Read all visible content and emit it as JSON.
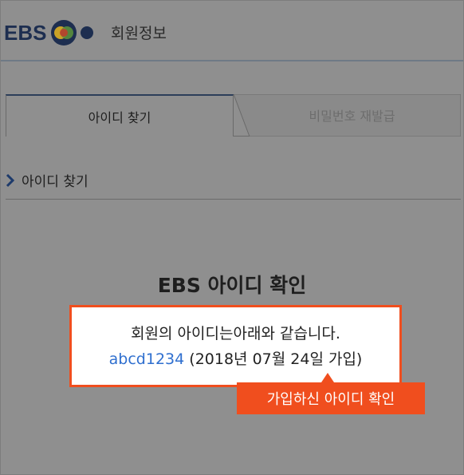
{
  "header": {
    "logo_text": "EBS",
    "title": "회원정보"
  },
  "tabs": [
    {
      "label": "아이디 찾기",
      "active": true
    },
    {
      "label": "비밀번호 재발급",
      "active": false
    }
  ],
  "section": {
    "heading": "아이디 찾기",
    "icon": "chevron-right-icon"
  },
  "result": {
    "title": "EBS 아이디 확인",
    "message": "회원의 아이디는아래와 같습니다.",
    "user_id": "abcd1234",
    "join_info": "(2018년 07월 24일 가입)"
  },
  "callout": {
    "label": "가입하신 아이디 확인"
  },
  "colors": {
    "brand_navy": "#1d2e50",
    "accent_orange": "#f04e1e",
    "id_blue": "#2f6fcf",
    "dim_overlay": "#8f8f8f"
  }
}
